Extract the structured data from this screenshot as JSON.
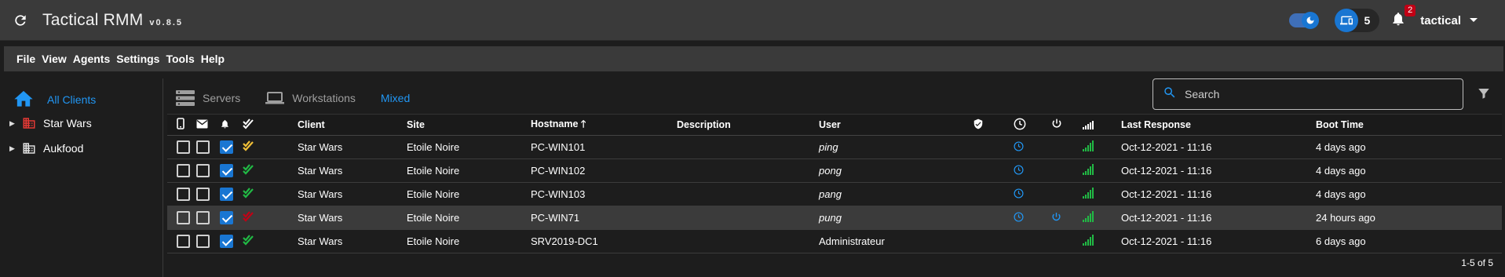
{
  "app": {
    "title": "Tactical RMM",
    "version": "v0.8.5"
  },
  "topbar": {
    "agent_count": "5",
    "alert_count": "2",
    "username": "tactical"
  },
  "menu": {
    "items": [
      "File",
      "View",
      "Agents",
      "Settings",
      "Tools",
      "Help"
    ]
  },
  "sidebar": {
    "all_clients": "All Clients",
    "clients": [
      {
        "name": "Star Wars",
        "color": "#e53935"
      },
      {
        "name": "Aukfood",
        "color": "#e0e0e0"
      }
    ]
  },
  "tabs": {
    "servers": "Servers",
    "workstations": "Workstations",
    "mixed": "Mixed",
    "active": "Mixed"
  },
  "search": {
    "placeholder": "Search"
  },
  "table": {
    "headers": {
      "client": "Client",
      "site": "Site",
      "hostname": "Hostname",
      "description": "Description",
      "user": "User",
      "last_response": "Last Response",
      "boot_time": "Boot Time"
    },
    "rows": [
      {
        "client": "Star Wars",
        "site": "Etoile Noire",
        "hostname": "PC-WIN101",
        "description": "",
        "user": "ping",
        "last_response": "Oct-12-2021 - 11:16",
        "boot_time": "4 days ago",
        "check_status": "warning",
        "check_color": "#f2c037",
        "maintenance": true,
        "reboot": false,
        "selected": false
      },
      {
        "client": "Star Wars",
        "site": "Etoile Noire",
        "hostname": "PC-WIN102",
        "description": "",
        "user": "pong",
        "last_response": "Oct-12-2021 - 11:16",
        "boot_time": "4 days ago",
        "check_status": "passing",
        "check_color": "#21ba45",
        "maintenance": true,
        "reboot": false,
        "selected": false
      },
      {
        "client": "Star Wars",
        "site": "Etoile Noire",
        "hostname": "PC-WIN103",
        "description": "",
        "user": "pang",
        "last_response": "Oct-12-2021 - 11:16",
        "boot_time": "4 days ago",
        "check_status": "passing",
        "check_color": "#21ba45",
        "maintenance": true,
        "reboot": false,
        "selected": false
      },
      {
        "client": "Star Wars",
        "site": "Etoile Noire",
        "hostname": "PC-WIN71",
        "description": "",
        "user": "pung",
        "last_response": "Oct-12-2021 - 11:16",
        "boot_time": "24 hours ago",
        "check_status": "failing",
        "check_color": "#c10015",
        "maintenance": true,
        "reboot": true,
        "selected": true
      },
      {
        "client": "Star Wars",
        "site": "Etoile Noire",
        "hostname": "SRV2019-DC1",
        "description": "",
        "user": "Administrateur",
        "last_response": "Oct-12-2021 - 11:16",
        "boot_time": "6 days ago",
        "check_status": "passing",
        "check_color": "#21ba45",
        "maintenance": false,
        "reboot": false,
        "selected": false
      }
    ],
    "footer": "1-5 of 5"
  },
  "colors": {
    "accent": "#2196f3",
    "signal": "#21ba45"
  }
}
